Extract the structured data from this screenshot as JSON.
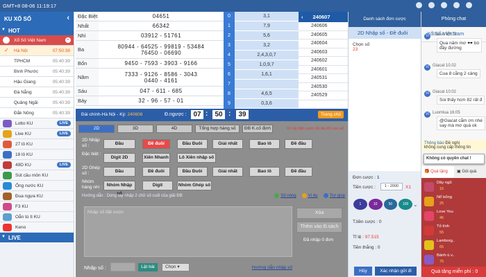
{
  "topbar": {
    "time": "GMT+8 08-06 11:19:17"
  },
  "sidebar": {
    "title": "KU XỔ SỐ",
    "hot_label": "HOT",
    "regions": [
      {
        "label": "Xổ Số Việt Nam",
        "time": "",
        "state": "active"
      },
      {
        "label": "Hà Nội",
        "time": "07:50:38",
        "state": "hl"
      },
      {
        "label": "TPHCM",
        "time": "05:40:39",
        "state": ""
      },
      {
        "label": "Bình Phước",
        "time": "05:40:39",
        "state": ""
      },
      {
        "label": "Hậu Giang",
        "time": "05:40:39",
        "state": ""
      },
      {
        "label": "Đà Nẵng",
        "time": "05:40:39",
        "state": ""
      },
      {
        "label": "Quảng Ngãi",
        "time": "05:40:39",
        "state": ""
      },
      {
        "label": "Đắk Nông",
        "time": "05:40:39",
        "state": ""
      }
    ],
    "games": [
      {
        "label": "Lotto KU",
        "live": "LIVE",
        "icon_color": "#7b5cc4"
      },
      {
        "label": "Live KU",
        "live": "LIVE",
        "icon_color": "#e3a417"
      },
      {
        "label": "27 lô KU",
        "live": "",
        "icon_color": "#e05a3a"
      },
      {
        "label": "18 lô KU",
        "live": "",
        "icon_color": "#3c6fc4"
      },
      {
        "label": "49D KU",
        "live": "LIVE",
        "icon_color": "#c23a3a"
      },
      {
        "label": "Sút cầu môn KU",
        "live": "",
        "icon_color": "#3a9a4a"
      },
      {
        "label": "Ống nước KU",
        "live": "",
        "icon_color": "#2a8ad8"
      },
      {
        "label": "Đua ngựa KU",
        "live": "",
        "icon_color": "#a0632a"
      },
      {
        "label": "F3 KU",
        "live": "",
        "icon_color": "#d04a8a"
      },
      {
        "label": "Oẳn tù tì KU",
        "live": "",
        "icon_color": "#5aa0d0"
      },
      {
        "label": "Keno",
        "live": "",
        "icon_color": "#e33"
      }
    ],
    "live_label": "LIVE"
  },
  "results": {
    "rows": [
      {
        "label": "Đặc Biệt",
        "lines": [
          "04651"
        ]
      },
      {
        "label": "Nhất",
        "lines": [
          "66342"
        ]
      },
      {
        "label": "Nhì",
        "lines": [
          "03912 - 51761"
        ]
      },
      {
        "label": "Ba",
        "lines": [
          "80944 - 64525 - 99819 - 53484",
          "76450 - 06690"
        ]
      },
      {
        "label": "Bốn",
        "lines": [
          "9450 - 7593 - 3903 - 9166"
        ]
      },
      {
        "label": "Năm",
        "lines": [
          "7333 - 9126 - 8586 - 3043",
          "0440 - 4161"
        ]
      },
      {
        "label": "Sáu",
        "lines": [
          "047 - 611 - 685"
        ]
      },
      {
        "label": "Bảy",
        "lines": [
          "32 - 96 - 57 - 01"
        ]
      }
    ],
    "dau": [
      {
        "k": "0",
        "v": "3,1"
      },
      {
        "k": "1",
        "v": "7,9"
      },
      {
        "k": "2",
        "v": "5,6"
      },
      {
        "k": "3",
        "v": "3,2"
      },
      {
        "k": "4",
        "v": "2,4,3,0,7"
      },
      {
        "k": "5",
        "v": "1,0,9,7"
      },
      {
        "k": "6",
        "v": "1,6,1"
      },
      {
        "k": "7",
        "v": ""
      },
      {
        "k": "8",
        "v": "4,6,5"
      },
      {
        "k": "9",
        "v": "0,3,6"
      }
    ],
    "period_head": "240607",
    "periods": [
      "240606",
      "240605",
      "240604",
      "240603",
      "240602",
      "240601",
      "240531",
      "240530",
      "240529"
    ]
  },
  "bet": {
    "region_label": "Đài chính-Hà Nội",
    "ky_label": "Kỳ",
    "ky_value": "240608",
    "countdown_label": "Đ.ngược :",
    "hh": "07",
    "mm": "50",
    "ss": "39",
    "home_btn": "Trang chủ",
    "tabs": [
      "2D",
      "3D",
      "4D",
      "Tổng hợp hàng số",
      "ĐB K.cố định"
    ],
    "warning": "K1 kỳ đặt cược tối đa 65 con số",
    "rows": [
      {
        "label": "2D Nhập số :",
        "buttons": [
          "Đầu",
          "Đề đuôi",
          "Đầu Đuôi",
          "Giải nhất",
          "Bao lô",
          "Đề đầu"
        ]
      },
      {
        "label": "Đặc biệt :",
        "buttons": [
          "Digit 2D",
          "Xiên Nhanh",
          "Lô Xiên nhập số"
        ]
      },
      {
        "label": "2D Ghép số :",
        "buttons": [
          "Đầu",
          "Đề đuôi",
          "Đầu Đuôi",
          "Giải nhất",
          "Bao lô",
          "Đề đầu"
        ]
      },
      {
        "label": "Nhóm hàng nhì :",
        "buttons": [
          "Nhóm Nhập số",
          "Digit",
          "Nhóm Ghép số"
        ]
      }
    ],
    "guide": "Hướng dẫn : Dùng tay nhập 2 chữ số cuối của giải ĐB",
    "guide_tail": "",
    "links": [
      "Số nóng",
      "Ví dụ",
      "Trợ giúp"
    ],
    "textarea_placeholder": "Nhập số đặt cược",
    "delete_btn": "Xóa",
    "add_btn": "Thêm vào Đ.sách",
    "entered": "Đã nhập 0 đơn",
    "input_label": "Nhập số :",
    "pick_btn": "Lật bài",
    "choose_btn": "Chọn",
    "guide_link": "Hướng dẫn nhập số"
  },
  "orders": {
    "header": "Danh sách đơn cược",
    "tab": "2D Nhập số - Đề đuôi",
    "chosen_label": "Chọn số",
    "chosen_count": "23",
    "bet_count_label": "Đơn cược :",
    "bet_count_value": "1",
    "bet_amount_label": "Tiền cược :",
    "bet_amount_select": "1 - 2000",
    "bet_amount_mult": "X1",
    "chips": [
      "1",
      "10",
      "50",
      "100"
    ],
    "total_label": "T.tiền cược :",
    "total_value": "0",
    "rate_label": "Tỉ lệ :",
    "rate_value": "97.515",
    "win_label": "Tiền thắng :",
    "win_value": "0",
    "cancel_btn": "Hủy",
    "confirm_btn": "Xác nhận gửi đi"
  },
  "chat": {
    "header": "Phòng chat",
    "subheader": "Xổ Số Việt Nam",
    "messages": [
      {
        "name": "Giacat 10:02",
        "text": "Qua năm mơ 🕶️ bò",
        "text2": "đầy đường"
      },
      {
        "name": "Giacat 10.02",
        "text": "Cua 8 cằng 2 càng",
        "text2": ""
      },
      {
        "name": "Giacat 10:02",
        "text": "Soi thấy hcm 82 rất đ",
        "text2": ""
      },
      {
        "name": "Luomlua 16:05",
        "text": "@Giacat cắm ơn nhé",
        "text2": "say mà mơ quá ok"
      }
    ],
    "notice_label": "Thông báo",
    "notice_text": "Đề nghị",
    "notice_text2": "không cung cấp thông tin",
    "permission": "Không có quyền chat !",
    "gift_tab": "Quà tặng",
    "giftpack_tab": "Gói quà",
    "gifts": [
      {
        "name": "Dây ngũ",
        "price": "15",
        "color": "#c44a6a"
      },
      {
        "name": "Nổ bỏng",
        "price": "25",
        "color": "#e5a21a"
      },
      {
        "name": "Love You",
        "price": "45",
        "color": "#e5456a"
      },
      {
        "name": "Tỏ tình",
        "price": "55",
        "color": "#d23a3a"
      },
      {
        "name": "Lamborg..",
        "price": "65",
        "color": "#e3c21a"
      },
      {
        "name": "Bánh ú v..",
        "price": "75",
        "color": "#8a5ac4"
      }
    ],
    "free_gift": "Quà tặng miễn phí : 0"
  },
  "colors": {
    "primary": "#2c6bb8",
    "header": "#2f5f9c",
    "accent_red": "#e64a4a",
    "live_badge": "#3d74c4"
  }
}
